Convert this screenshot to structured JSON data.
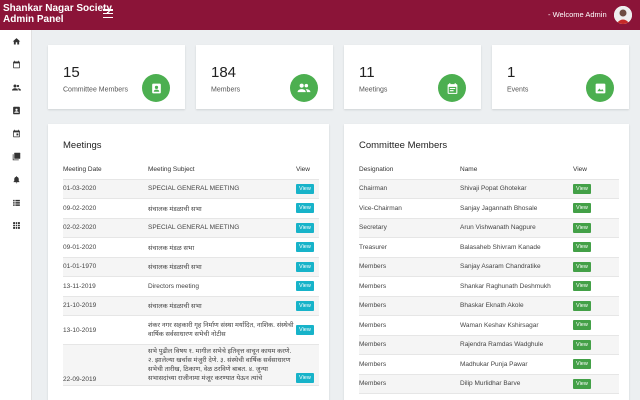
{
  "header": {
    "brand_line1": "Shankar Nagar Society",
    "brand_line2": "Admin Panel",
    "welcome": "- Welcome Admin"
  },
  "sidebar": {
    "items": [
      "home-icon",
      "calendar-icon",
      "people-icon",
      "contact-icon",
      "event-icon",
      "photo-library-icon",
      "bell-icon",
      "list-icon",
      "grid-icon"
    ]
  },
  "stats": [
    {
      "value": "15",
      "label": "Committee Members",
      "icon": "contact-card-icon"
    },
    {
      "value": "184",
      "label": "Members",
      "icon": "people-icon"
    },
    {
      "value": "11",
      "label": "Meetings",
      "icon": "event-icon"
    },
    {
      "value": "1",
      "label": "Events",
      "icon": "photo-icon"
    }
  ],
  "colors": {
    "header": "#8b1438",
    "stat_icon": "#4caf50",
    "view_cyan": "#17b3c9",
    "view_green": "#43a047"
  },
  "meetings": {
    "title": "Meetings",
    "columns": [
      "Meeting Date",
      "Meeting Subject",
      "View"
    ],
    "button_label": "View",
    "rows": [
      {
        "date": "01-03-2020",
        "subject": "SPECIAL GENERAL MEETING"
      },
      {
        "date": "09-02-2020",
        "subject": "संचालक मंडळाची सभा"
      },
      {
        "date": "02-02-2020",
        "subject": "SPECIAL GENERAL MEETING"
      },
      {
        "date": "09-01-2020",
        "subject": "संचालक मंडळ सभा"
      },
      {
        "date": "01-01-1970",
        "subject": "संचालक मंडळाची सभा"
      },
      {
        "date": "13-11-2019",
        "subject": "Directors meeting"
      },
      {
        "date": "21-10-2019",
        "subject": "संचालक मंडळाची सभा"
      },
      {
        "date": "13-10-2019",
        "subject": "शंकर नगर सहकारी गृह निर्माण संस्था मर्यादित, नाशिक. संस्थेची वार्षिक सर्वसाधारण सभेची नोटीस"
      },
      {
        "date": "22-09-2019",
        "subject": "सभे पुढील विषय १. मागील सभेचे इतिवृत्त वाचून कायम करणे. २. झालेल्या खर्चास मंजुरी देणे. ३. संस्थेची वार्षिक सर्वसाधारण सभेची तारीख, ठिकाण, वेळ ठरविणे बाबत. ४. जुन्या सभासदांच्या राजीनामा मंजूर करण्यात येऊन त्यांचे"
      }
    ]
  },
  "committee": {
    "title": "Committee Members",
    "columns": [
      "Designation",
      "Name",
      "View"
    ],
    "button_label": "View",
    "rows": [
      {
        "designation": "Chairman",
        "name": "Shivaji Popat Ghotekar"
      },
      {
        "designation": "Vice-Chairman",
        "name": "Sanjay Jagannath Bhosale"
      },
      {
        "designation": "Secretary",
        "name": "Arun Vishwanath Nagpure"
      },
      {
        "designation": "Treasurer",
        "name": "Balasaheb Shivram Kanade"
      },
      {
        "designation": "Members",
        "name": "Sanjay Asaram Chandratike"
      },
      {
        "designation": "Members",
        "name": "Shankar Raghunath Deshmukh"
      },
      {
        "designation": "Members",
        "name": "Bhaskar Eknath Akole"
      },
      {
        "designation": "Members",
        "name": "Waman Keshav Kshirsagar"
      },
      {
        "designation": "Members",
        "name": "Rajendra Ramdas Wadghule"
      },
      {
        "designation": "Members",
        "name": "Madhukar Punja Pawar"
      },
      {
        "designation": "Members",
        "name": "Dilip Murlidhar Barve"
      }
    ]
  }
}
